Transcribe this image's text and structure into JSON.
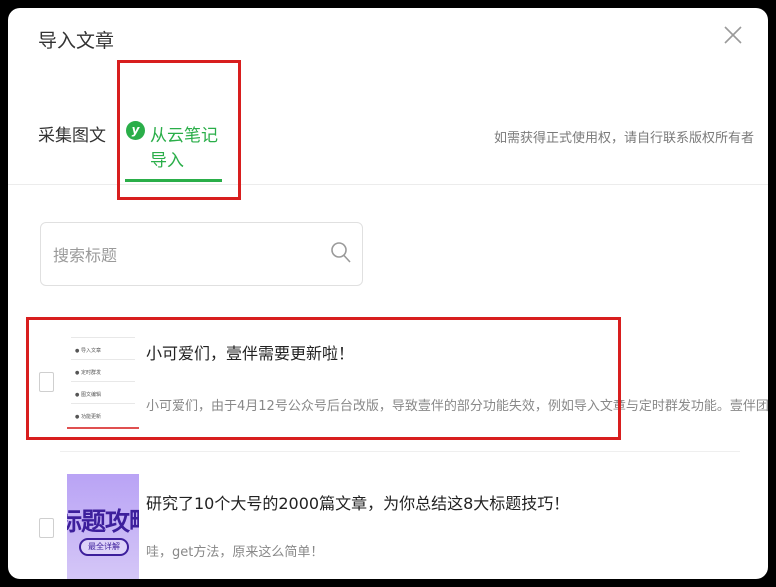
{
  "dialog": {
    "title": "导入文章"
  },
  "tabs": {
    "collect_label": "采集图文",
    "yunbiji_logo": "y",
    "yunbiji_label": "从云笔记导入",
    "active_color": "#2aae49"
  },
  "copyright_note": "如需获得正式使用权，请自行联系版权所有者",
  "search": {
    "placeholder": "搜索标题"
  },
  "articles": [
    {
      "title": "小可爱们，壹伴需要更新啦！",
      "desc": "小可爱们，由于4月12号公众号后台改版，导致壹伴的部分功能失效，例如导入文章与定时群发功能。壹伴团队",
      "thumb_lines": [
        "● 导入文章",
        "● 定时群发",
        "● 图文编辑",
        "● 功能更新"
      ]
    },
    {
      "title": "研究了10个大号的2000篇文章，为你总结这8大标题技巧！",
      "desc": "哇，get方法，原来这么简单！",
      "thumb_title": "标题攻略",
      "thumb_pill": "最全详解"
    }
  ],
  "colors": {
    "accent": "#2aae49",
    "highlight_box": "#d81e1e"
  }
}
